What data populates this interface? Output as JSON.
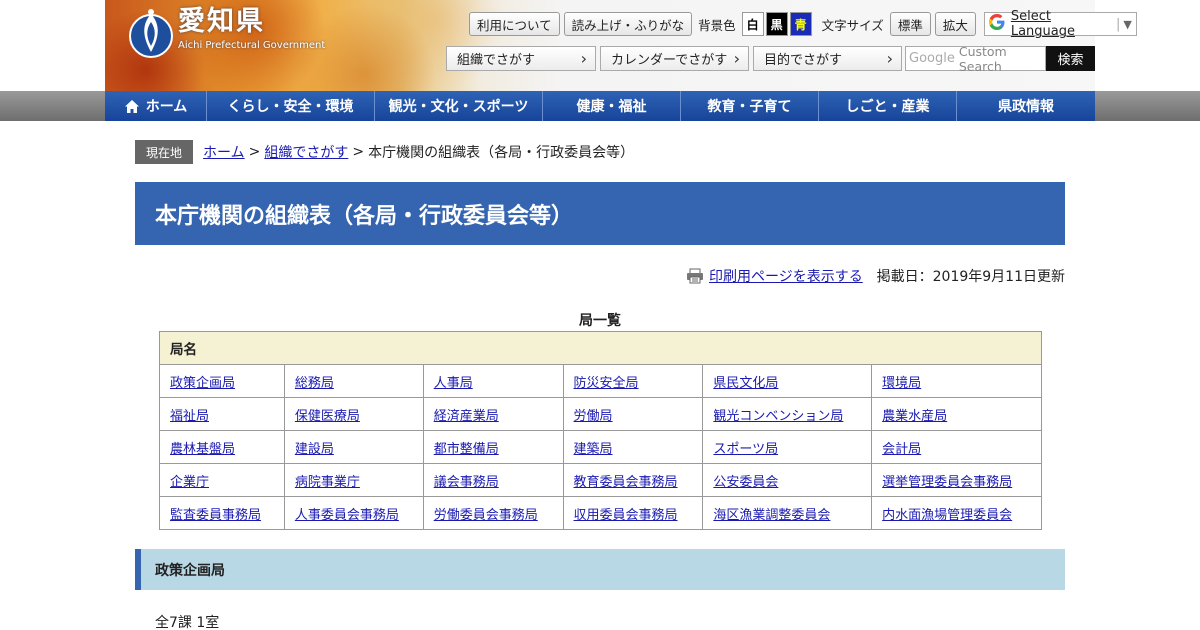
{
  "header": {
    "logo_ja": "愛知県",
    "logo_en": "Aichi Prefectural Government",
    "util": {
      "usage": "利用について",
      "readaloud": "読み上げ・ふりがな",
      "bg_label": "背景色",
      "bg_white": "白",
      "bg_black": "黒",
      "bg_blue": "青",
      "font_label": "文字サイズ",
      "font_standard": "標準",
      "font_large": "拡大"
    },
    "translate": {
      "label": "Select Language",
      "arrow": "▼"
    },
    "search_nav": [
      {
        "label": "組織でさがす"
      },
      {
        "label": "カレンダーでさがす"
      },
      {
        "label": "目的でさがす"
      }
    ],
    "search": {
      "placeholder": "Custom Search",
      "button": "検索"
    }
  },
  "global_nav": [
    {
      "label": "ホーム"
    },
    {
      "label": "くらし・安全・環境"
    },
    {
      "label": "観光・文化・スポーツ"
    },
    {
      "label": "健康・福祉"
    },
    {
      "label": "教育・子育て"
    },
    {
      "label": "しごと・産業"
    },
    {
      "label": "県政情報"
    }
  ],
  "breadcrumb": {
    "badge": "現在地",
    "home": "ホーム",
    "sep": ">",
    "parent": "組織でさがす",
    "current": "本庁機関の組織表（各局・行政委員会等）"
  },
  "page": {
    "title": "本庁機関の組織表（各局・行政委員会等）",
    "print_link": "印刷用ページを表示する",
    "date": "掲載日：2019年9月11日更新"
  },
  "table": {
    "caption": "局一覧",
    "header": "局名",
    "rows": [
      [
        "政策企画局",
        "総務局",
        "人事局",
        "防災安全局",
        "県民文化局",
        "環境局"
      ],
      [
        "福祉局",
        "保健医療局",
        "経済産業局",
        "労働局",
        "観光コンベンション局",
        "農業水産局"
      ],
      [
        "農林基盤局",
        "建設局",
        "都市整備局",
        "建築局",
        "スポーツ局",
        "会計局"
      ],
      [
        "企業庁",
        "病院事業庁",
        "議会事務局",
        "教育委員会事務局",
        "公安委員会",
        "選挙管理委員会事務局"
      ],
      [
        "監査委員事務局",
        "人事委員会事務局",
        "労働委員会事務局",
        "収用委員会事務局",
        "海区漁業調整委員会",
        "内水面漁場管理委員会"
      ]
    ]
  },
  "section": {
    "heading": "政策企画局",
    "summary": "全7課 1室"
  },
  "colors": {
    "nav_blue": "#2e63b5",
    "title_blue": "#3565b0",
    "table_header_bg": "#f4f2d2",
    "section_bg": "#b8d8e6",
    "link": "#1a1ab0"
  }
}
